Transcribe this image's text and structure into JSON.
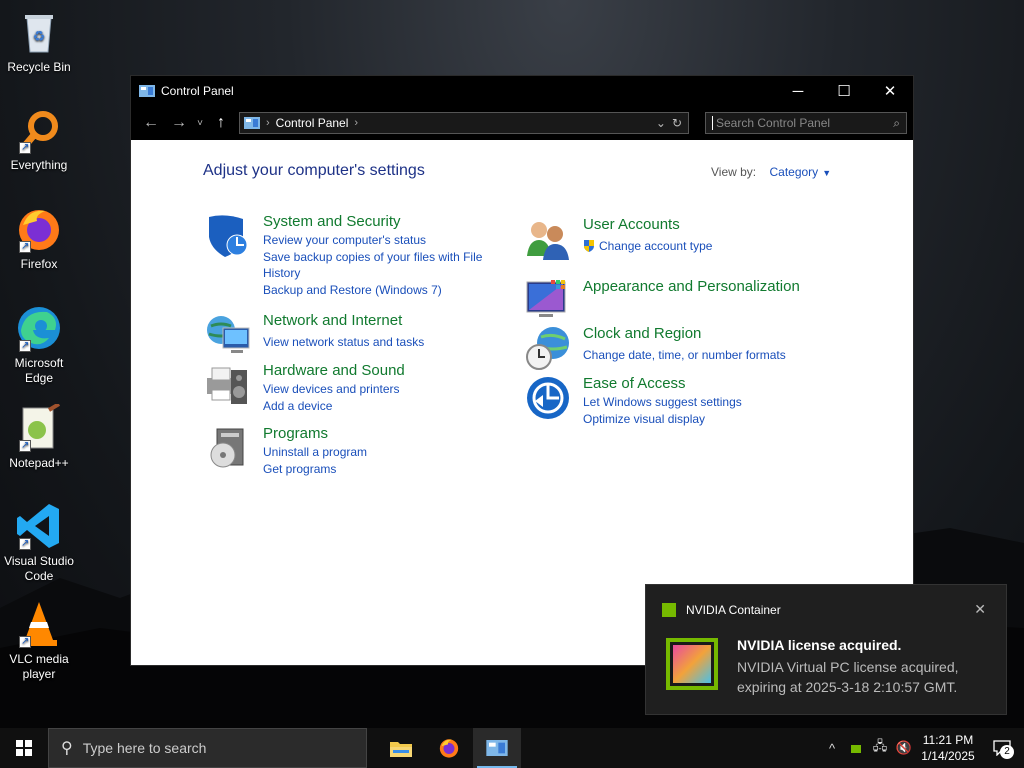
{
  "desktop": {
    "icons": [
      {
        "label": "Recycle Bin",
        "icon": "recycle-bin-icon"
      },
      {
        "label": "Everything",
        "icon": "everything-search-icon"
      },
      {
        "label": "Firefox",
        "icon": "firefox-icon"
      },
      {
        "label": "Microsoft Edge",
        "icon": "edge-icon"
      },
      {
        "label": "Notepad++",
        "icon": "notepadpp-icon"
      },
      {
        "label": "Visual Studio Code",
        "icon": "vscode-icon"
      },
      {
        "label": "VLC media player",
        "icon": "vlc-icon"
      }
    ]
  },
  "window": {
    "title": "Control Panel",
    "controls": {
      "minimize": "─",
      "maximize": "☐",
      "close": "✕"
    }
  },
  "address": {
    "crumb": "Control Panel",
    "separator": "›",
    "trailing_separator": "›"
  },
  "search": {
    "placeholder": "Search Control Panel"
  },
  "main": {
    "heading": "Adjust your computer's settings",
    "view_by_label": "View by:",
    "view_by_value": "Category"
  },
  "categories": {
    "system": {
      "title": "System and Security",
      "links": [
        "Review your computer's status",
        "Save backup copies of your files with File History",
        "Backup and Restore (Windows 7)"
      ]
    },
    "network": {
      "title": "Network and Internet",
      "links": [
        "View network status and tasks"
      ]
    },
    "hardware": {
      "title": "Hardware and Sound",
      "links": [
        "View devices and printers",
        "Add a device"
      ]
    },
    "programs": {
      "title": "Programs",
      "links": [
        "Uninstall a program",
        "Get programs"
      ]
    },
    "accounts": {
      "title": "User Accounts",
      "links": [
        "Change account type"
      ]
    },
    "appearance": {
      "title": "Appearance and Personalization",
      "links": []
    },
    "clock": {
      "title": "Clock and Region",
      "links": [
        "Change date, time, or number formats"
      ]
    },
    "ease": {
      "title": "Ease of Access",
      "links": [
        "Let Windows suggest settings",
        "Optimize visual display"
      ]
    }
  },
  "toast": {
    "app": "NVIDIA Container",
    "title": "NVIDIA license acquired.",
    "body": "NVIDIA Virtual PC license acquired, expiring at 2025-3-18 2:10:57 GMT.",
    "close": "✕"
  },
  "taskbar": {
    "search_placeholder": "Type here to search",
    "apps": [
      "file-explorer-icon",
      "firefox-icon",
      "control-panel-icon"
    ],
    "time": "11:21 PM",
    "date": "1/14/2025",
    "notification_count": "2",
    "colors": {
      "accent": "#76b9ed",
      "nvidia": "#76b900"
    }
  }
}
